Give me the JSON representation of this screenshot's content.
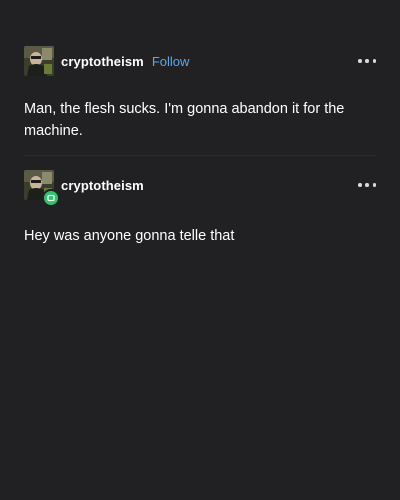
{
  "posts": [
    {
      "username": "cryptotheism",
      "follow_label": "Follow",
      "avatar_icon": "avatar-image",
      "more_icon": "more-options-icon",
      "text": "Man, the flesh sucks. I'm gonna abandon it for the machine."
    },
    {
      "username": "cryptotheism",
      "avatar_icon": "avatar-image",
      "badge_icon": "online-status-badge-icon",
      "more_icon": "more-options-icon",
      "text": "Hey was anyone gonna telle that"
    }
  ],
  "colors": {
    "background": "#212022",
    "text": "#ffffff",
    "follow": "#5aa9ee",
    "badge": "#31c36b"
  }
}
